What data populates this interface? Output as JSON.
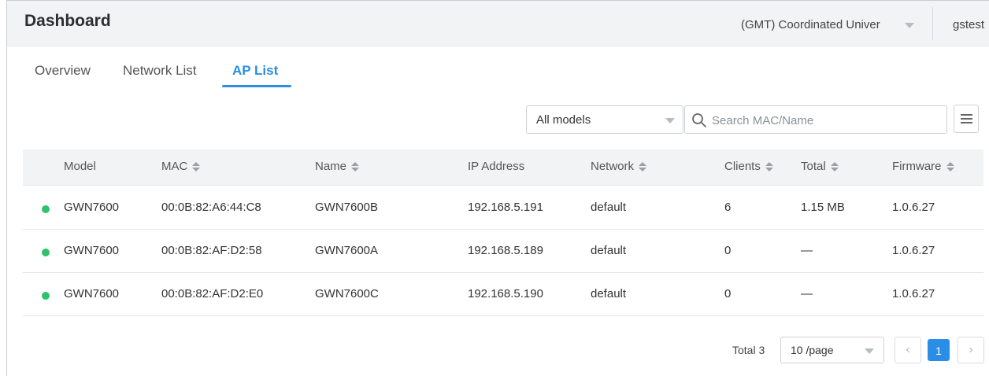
{
  "header": {
    "title": "Dashboard",
    "timezone": "(GMT) Coordinated Univer",
    "user": "gstest"
  },
  "tabs": [
    {
      "label": "Overview",
      "active": false
    },
    {
      "label": "Network List",
      "active": false
    },
    {
      "label": "AP List",
      "active": true
    }
  ],
  "filters": {
    "model_select": "All models",
    "search_placeholder": "Search MAC/Name"
  },
  "table": {
    "columns": [
      "Model",
      "MAC",
      "Name",
      "IP Address",
      "Network",
      "Clients",
      "Total",
      "Firmware"
    ],
    "rows": [
      {
        "status": "online",
        "model": "GWN7600",
        "mac": "00:0B:82:A6:44:C8",
        "name": "GWN7600B",
        "ip": "192.168.5.191",
        "network": "default",
        "clients": "6",
        "total": "1.15 MB",
        "firmware": "1.0.6.27"
      },
      {
        "status": "online",
        "model": "GWN7600",
        "mac": "00:0B:82:AF:D2:58",
        "name": "GWN7600A",
        "ip": "192.168.5.189",
        "network": "default",
        "clients": "0",
        "total": "—",
        "firmware": "1.0.6.27"
      },
      {
        "status": "online",
        "model": "GWN7600",
        "mac": "00:0B:82:AF:D2:E0",
        "name": "GWN7600C",
        "ip": "192.168.5.190",
        "network": "default",
        "clients": "0",
        "total": "—",
        "firmware": "1.0.6.27"
      }
    ]
  },
  "pagination": {
    "total_label": "Total 3",
    "page_size": "10 /page",
    "current_page": "1",
    "prev_icon": "chevron-left-icon",
    "next_icon": "chevron-right-icon"
  },
  "colors": {
    "accent": "#2a8ee6",
    "status_online": "#2dc26b"
  }
}
